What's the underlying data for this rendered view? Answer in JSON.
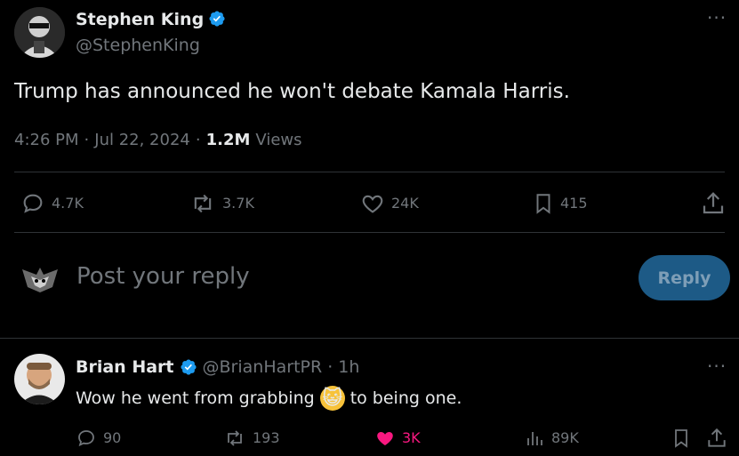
{
  "tweet": {
    "author_name": "Stephen King",
    "author_handle": "@StephenKing",
    "text": "Trump has announced he won't debate Kamala Harris.",
    "time": "4:26 PM",
    "dot1": "·",
    "date": "Jul 22, 2024",
    "dot2": "·",
    "views_count": "1.2M",
    "views_label": "Views",
    "more": "···",
    "replies": "4.7K",
    "reposts": "3.7K",
    "likes": "24K",
    "bookmarks": "415"
  },
  "composer": {
    "placeholder": "Post your reply",
    "reply_label": "Reply"
  },
  "reply": {
    "author_name": "Brian Hart",
    "author_handle": "@BrianHartPR",
    "dot": "·",
    "time": "1h",
    "more": "···",
    "text_before": "Wow he went from grabbing",
    "emoji": "😺",
    "text_after": "to being one.",
    "replies": "90",
    "reposts": "193",
    "likes": "3K",
    "views": "89K"
  },
  "colors": {
    "background": "#000000",
    "verified": "#1d9bf0",
    "like_active": "#f91880",
    "reply_button": "#1d5a86"
  }
}
